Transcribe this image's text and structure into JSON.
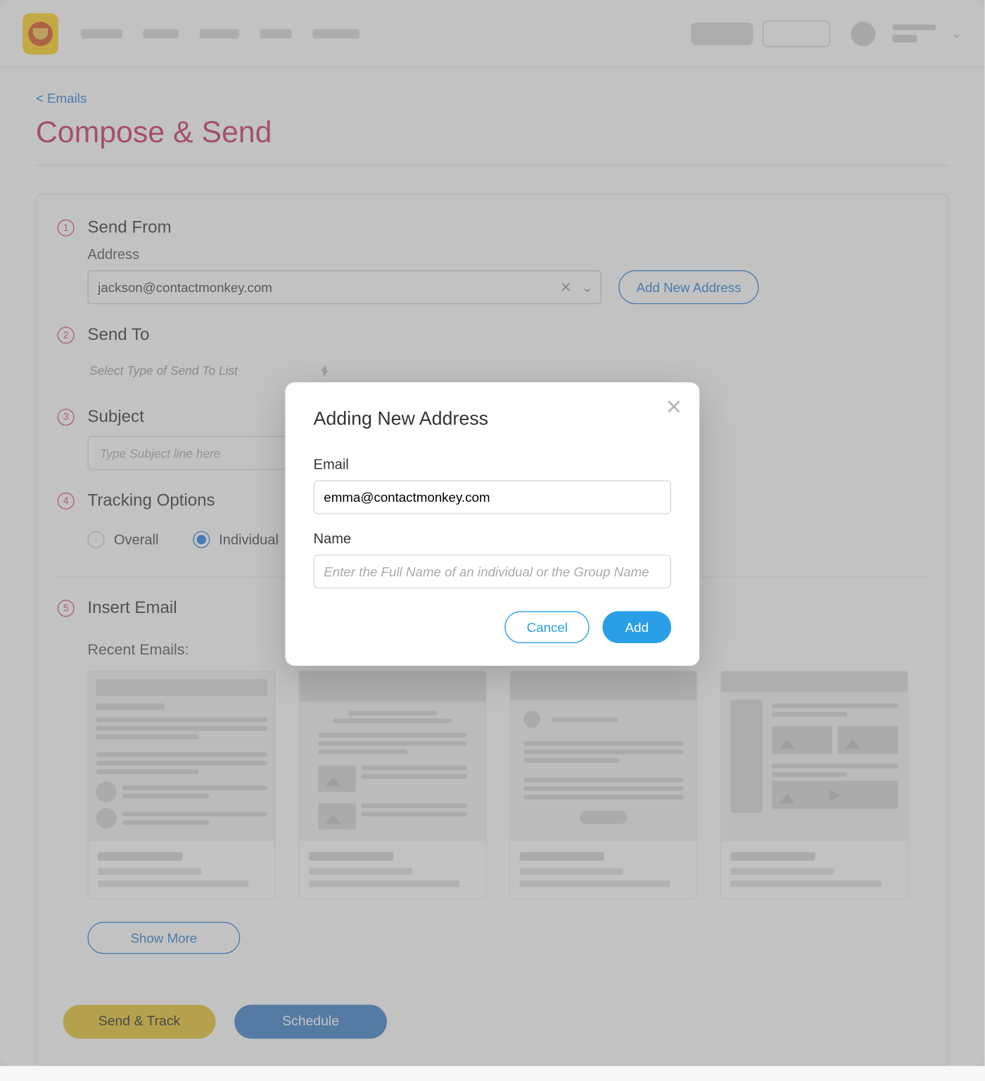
{
  "header": {
    "back_link": "< Emails",
    "page_title": "Compose & Send"
  },
  "steps": {
    "s1": {
      "num": "1",
      "title": "Send From",
      "address_label": "Address",
      "address_value": "jackson@contactmonkey.com",
      "add_button": "Add New Address"
    },
    "s2": {
      "num": "2",
      "title": "Send To",
      "placeholder": "Select Type of Send To List"
    },
    "s3": {
      "num": "3",
      "title": "Subject",
      "placeholder": "Type Subject line here"
    },
    "s4": {
      "num": "4",
      "title": "Tracking Options",
      "opt_overall": "Overall",
      "opt_individual": "Individual"
    },
    "s5": {
      "num": "5",
      "title": "Insert Email",
      "recent_label": "Recent Emails:",
      "show_more": "Show More"
    }
  },
  "actions": {
    "send_track": "Send & Track",
    "schedule": "Schedule"
  },
  "modal": {
    "title": "Adding New Address",
    "email_label": "Email",
    "email_value": "emma@contactmonkey.com",
    "name_label": "Name",
    "name_placeholder": "Enter the Full Name of an individual or the Group Name",
    "cancel": "Cancel",
    "add": "Add"
  }
}
